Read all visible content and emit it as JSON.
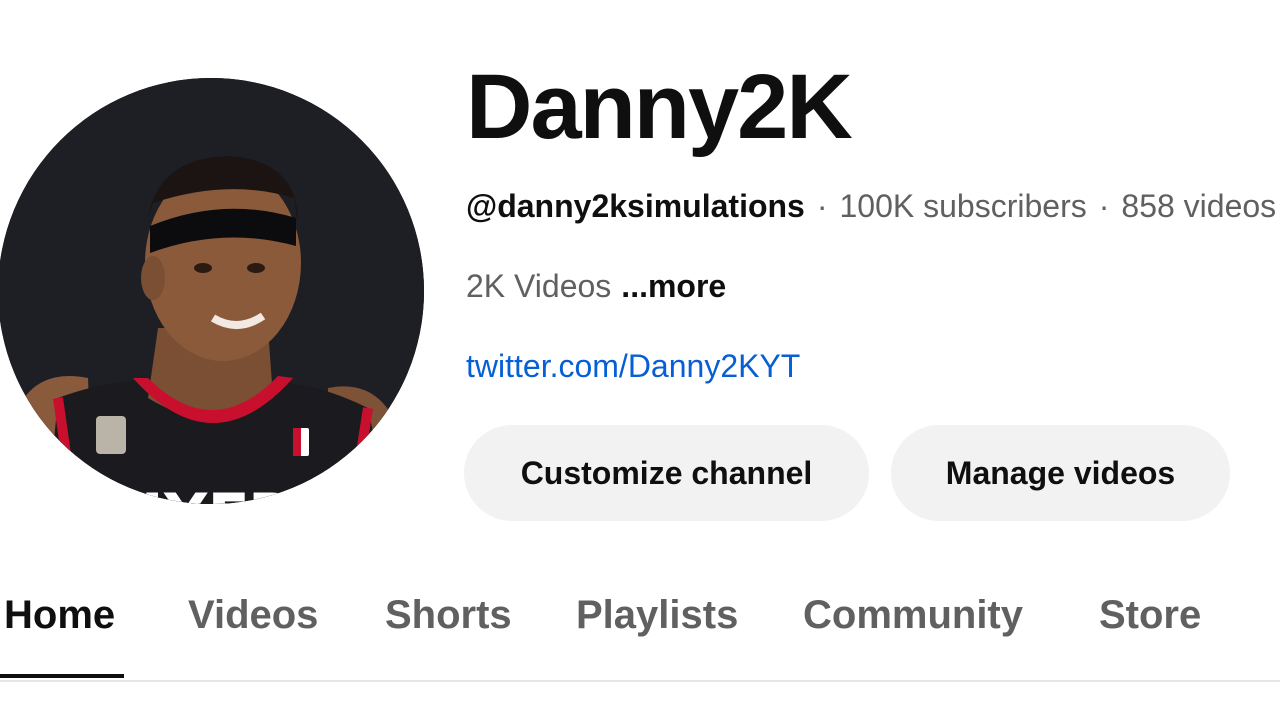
{
  "channel": {
    "name": "Danny2K",
    "handle": "@danny2ksimulations",
    "subscribers": "100K subscribers",
    "videos_count": "858 videos",
    "description": "2K Videos",
    "more_label": "...more",
    "link": "twitter.com/Danny2KYT"
  },
  "buttons": {
    "customize_label": "Customize channel",
    "manage_label": "Manage videos"
  },
  "tabs": [
    {
      "label": "Home",
      "active": true
    },
    {
      "label": "Videos",
      "active": false
    },
    {
      "label": "Shorts",
      "active": false
    },
    {
      "label": "Playlists",
      "active": false
    },
    {
      "label": "Community",
      "active": false
    },
    {
      "label": "Store",
      "active": false
    }
  ],
  "colors": {
    "accent_link": "#065fd4",
    "button_bg": "#f2f2f2",
    "text_primary": "#0f0f0f",
    "text_secondary": "#606060"
  }
}
